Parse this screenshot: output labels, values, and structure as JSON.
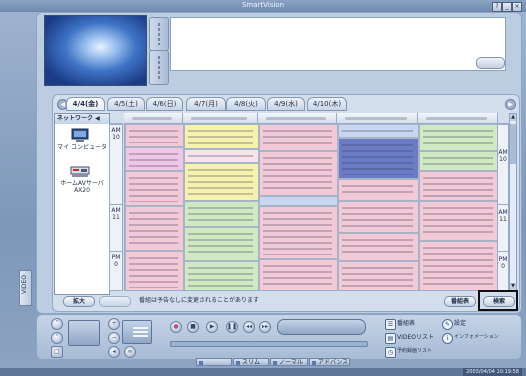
{
  "window": {
    "title": "SmartVision",
    "help_label": "?",
    "min_label": "_",
    "close_label": "×"
  },
  "date_tabs": [
    "4/4(金)",
    "4/5(土)",
    "4/6(日)",
    "4/7(月)",
    "4/8(火)",
    "4/9(水)",
    "4/10(木)"
  ],
  "date_nav": {
    "prev": "◀",
    "next": "▶"
  },
  "network": {
    "header": "ネットワーク ◀",
    "items": [
      {
        "label": "マイ コンピュータ",
        "icon": "computer-icon"
      },
      {
        "label": "ホームAVサーバ",
        "sub": "AX20",
        "icon": "av-server-icon"
      }
    ]
  },
  "time_labels": [
    {
      "ampm": "AM",
      "hour": "10"
    },
    {
      "ampm": "AM",
      "hour": "11"
    },
    {
      "ampm": "PM",
      "hour": "0"
    }
  ],
  "epg_footer": {
    "expand": "拡大",
    "secondary": "",
    "notice": "番組は予告なしに変更されることがあります",
    "guide": "番組表",
    "search": "検索"
  },
  "side_tab": "VIDEO",
  "controls": {
    "guide": "番組表",
    "settings": "設定",
    "video_list": "VIDEOリスト",
    "info": "インフォメーション",
    "rec_list": "予約録画リスト"
  },
  "layout_tabs": [
    "",
    "スリム",
    "ノーマル",
    "アドバンス"
  ],
  "status": {
    "datetime": "2003/04/04 10:19:58"
  },
  "colors": {
    "frame": "#8da4c3",
    "program_pink": "#f2c9d6",
    "program_yellow": "#f7f1ae",
    "program_green": "#cfe9c3",
    "program_blue": "#6b7cc6",
    "highlight_border": "#111111"
  }
}
